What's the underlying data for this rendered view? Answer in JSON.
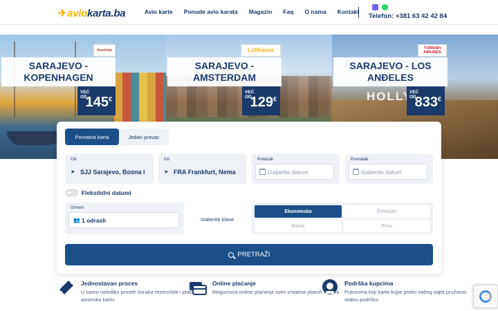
{
  "header": {
    "logo": {
      "prefix": "avio",
      "suffix": "karta.ba"
    },
    "nav": [
      "Avio karte",
      "Ponude avio karata",
      "Magazin",
      "Faq",
      "O nama",
      "Kontakt"
    ],
    "phone": "Telefon: +381 63 42 42 84",
    "social_icons": [
      "viber-icon",
      "whatsapp-icon"
    ]
  },
  "offers": [
    {
      "city": "SARAJEVO - KOPENHAGEN",
      "airline": "Austrian",
      "from": "VEĆ OD",
      "price": "145",
      "currency": "€"
    },
    {
      "city": "SARAJEVO - AMSTERDAM",
      "airline": "Lufthansa",
      "from": "VEĆ OD",
      "price": "129",
      "currency": "€"
    },
    {
      "city": "SARAJEVO - LOS ANĐELES",
      "airline": "TURKISH AIRLINES",
      "from": "VEĆ OD",
      "price": "833",
      "currency": "€",
      "sign": "HOLLY"
    }
  ],
  "search": {
    "tabs": [
      "Povratna karta",
      "Jedan pravac"
    ],
    "from": {
      "label": "Od",
      "value": "SJJ Sarajevo, Bosna i"
    },
    "to": {
      "label": "Do",
      "value": "FRA Frankfurt, Nema"
    },
    "depart": {
      "label": "Polazak",
      "placeholder": "Izaberite datum"
    },
    "return": {
      "label": "Povratak",
      "placeholder": "Izaberite datum"
    },
    "flexible": "Fleksibilni datumi",
    "passengers": {
      "label": "Izmeni",
      "value": "1 odrasli"
    },
    "class_label": "Izaberite klase",
    "classes": [
      "Ekonomska",
      "Premium",
      "Biznis",
      "Prva"
    ],
    "selected_class": "Ekonomska",
    "submit": "PRETRAŽI"
  },
  "features": [
    {
      "title": "Jednostavan proces",
      "text": "U samo nekoliko prostih koraka rezervišite i platite avionsku kartu",
      "icon": "ticket-icon"
    },
    {
      "title": "Online plaćanje",
      "text": "Mogućnost online plaćanja svim vrstama platnih kartica",
      "icon": "card-icon"
    },
    {
      "title": "Podrška kupcima",
      "text": "Putnicima koji karte kupe preko našeg sajta pružamo stalnu podršku",
      "icon": "support-icon"
    }
  ],
  "colors": {
    "primary": "#1b3a6b",
    "button": "#1b4f8a",
    "accent": "#f2b705"
  }
}
